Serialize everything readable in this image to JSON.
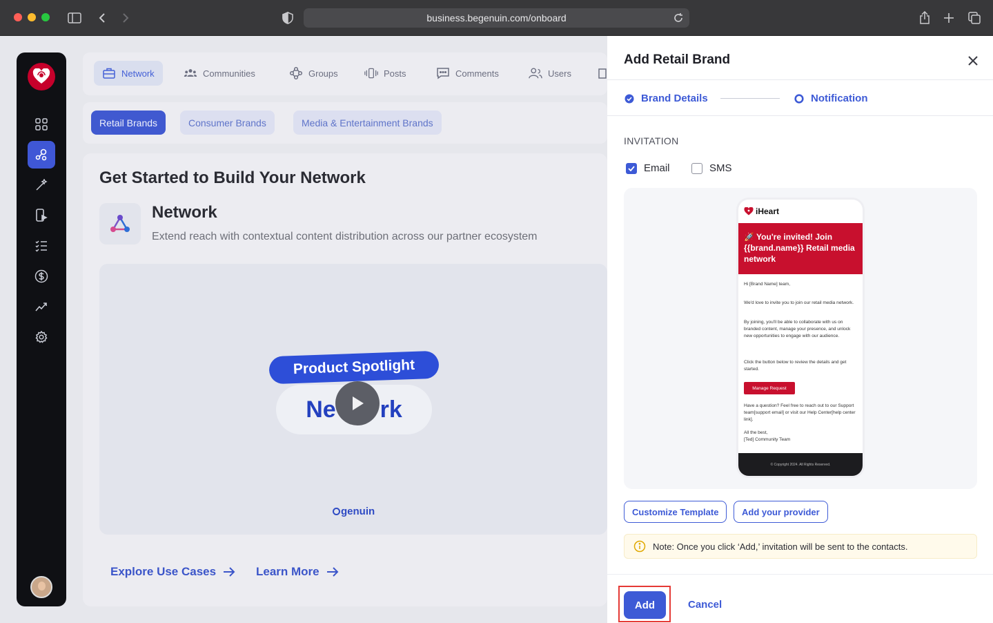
{
  "browser": {
    "url": "business.begenuin.com/onboard"
  },
  "topnav": {
    "items": [
      {
        "label": "Network",
        "icon": "briefcase-icon",
        "active": true
      },
      {
        "label": "Communities",
        "icon": "people-icon"
      },
      {
        "label": "Groups",
        "icon": "groups-icon"
      },
      {
        "label": "Posts",
        "icon": "posts-icon"
      },
      {
        "label": "Comments",
        "icon": "comment-icon"
      },
      {
        "label": "Users",
        "icon": "users-icon"
      }
    ]
  },
  "subtabs": [
    {
      "label": "Retail Brands",
      "active": true
    },
    {
      "label": "Consumer Brands"
    },
    {
      "label": "Media & Entertainment Brands"
    }
  ],
  "card": {
    "title": "Get Started to Build Your Network",
    "network_heading": "Network",
    "network_desc": "Extend reach with contextual content distribution across our partner ecosystem",
    "video_title": "Product Spotlight",
    "video_word_left": "Ne",
    "video_word_right": "rk",
    "video_brand": "genuin",
    "links": [
      "Explore Use Cases",
      "Learn More"
    ]
  },
  "drawer": {
    "title": "Add Retail Brand",
    "steps": [
      "Brand Details",
      "Notification"
    ],
    "section_label": "INVITATION",
    "channels": [
      {
        "label": "Email",
        "checked": true
      },
      {
        "label": "SMS",
        "checked": false
      }
    ],
    "preview": {
      "brand": "iHeart",
      "hero": "🚀 You're invited! Join {{brand.name}} Retail media network",
      "greeting": "Hi [Brand Name] team,",
      "p1": "We'd love to invite you to join our retail media network.",
      "p2": "By joining, you'll be able to collaborate with us on branded content, manage your presence, and unlock new opportunities to engage with our audience.",
      "p3": "Click the button below to review the details and get started.",
      "button": "Manage Request",
      "p4": "Have a question? Feel free to reach out to our Support team[support email] or visit our Help Center[help center link].",
      "signoff1": "All the best,",
      "signoff2": "[Ted] Community Team",
      "footer": "© Copyright 2024. All Rights Reserved."
    },
    "customize_label": "Customize Template",
    "provider_label": "Add your provider",
    "note": "Note: Once you click ‘Add,’ invitation will be sent to the contacts.",
    "add_label": "Add",
    "cancel_label": "Cancel"
  },
  "colors": {
    "accent": "#3d5ad6",
    "brand_red": "#c8102e",
    "sidebar_bg": "#0f1014"
  }
}
